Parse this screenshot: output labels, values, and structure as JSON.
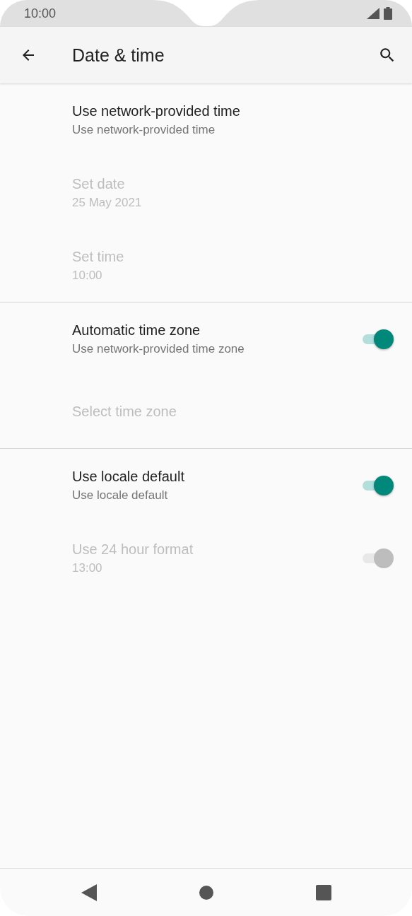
{
  "status_bar": {
    "time": "10:00"
  },
  "toolbar": {
    "title": "Date & time"
  },
  "sections": [
    {
      "items": [
        {
          "title": "Use network-provided time",
          "summary": "Use network-provided time",
          "disabled": false
        },
        {
          "title": "Set date",
          "summary": "25 May 2021",
          "disabled": true
        },
        {
          "title": "Set time",
          "summary": "10:00",
          "disabled": true
        }
      ]
    },
    {
      "items": [
        {
          "title": "Automatic time zone",
          "summary": "Use network-provided time zone",
          "disabled": false,
          "switch": {
            "on": true
          }
        },
        {
          "title": "Select time zone",
          "disabled": true
        }
      ]
    },
    {
      "items": [
        {
          "title": "Use locale default",
          "summary": "Use locale default",
          "disabled": false,
          "switch": {
            "on": true
          }
        },
        {
          "title": "Use 24 hour format",
          "summary": "13:00",
          "disabled": true,
          "switch": {
            "on": true
          }
        }
      ]
    }
  ]
}
